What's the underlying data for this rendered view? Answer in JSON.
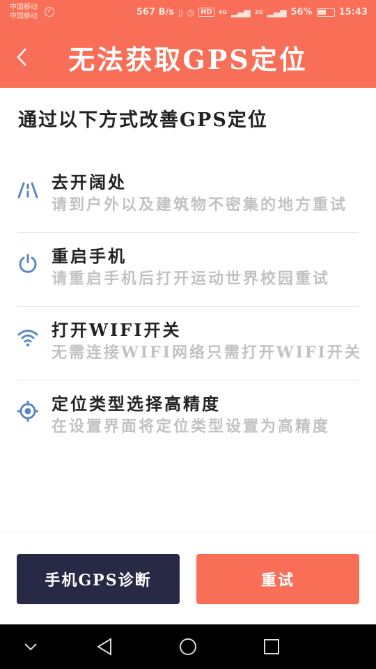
{
  "status_bar": {
    "carrier_1": "中国移动",
    "carrier_2": "中国移动",
    "network_speed": "567 B/s",
    "hd_badge": "HD",
    "net_4g": "4G",
    "net_2g": "2G",
    "battery_percent": "56%",
    "battery_level": 0.56,
    "time": "15:43"
  },
  "header": {
    "title": "无法获取GPS定位"
  },
  "section_title": "通过以下方式改善GPS定位",
  "tips": [
    {
      "icon": "road-icon",
      "title": "去开阔处",
      "description": "请到户外以及建筑物不密集的地方重试"
    },
    {
      "icon": "power-icon",
      "title": "重启手机",
      "description": "请重启手机后打开运动世界校园重试"
    },
    {
      "icon": "wifi-icon",
      "title": "打开WIFI开关",
      "description": "无需连接WIFI网络只需打开WIFI开关"
    },
    {
      "icon": "location-target-icon",
      "title": "定位类型选择高精度",
      "description": "在设置界面将定位类型设置为高精度"
    }
  ],
  "buttons": {
    "diagnose": "手机GPS诊断",
    "retry": "重试"
  },
  "colors": {
    "accent": "#f96e56",
    "dark_button": "#282a45",
    "icon_blue": "#5b86c5",
    "muted_text": "#c2c2c2"
  }
}
